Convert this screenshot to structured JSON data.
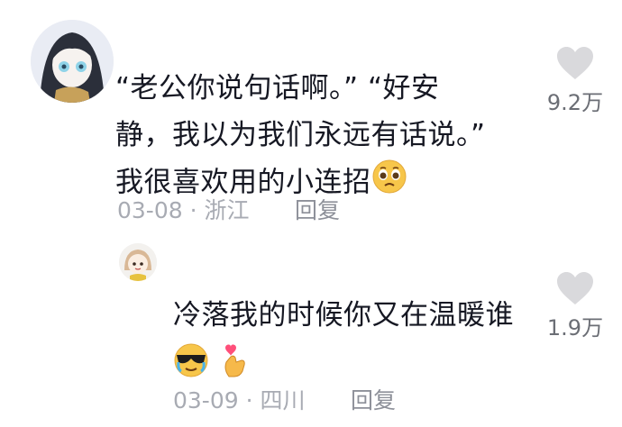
{
  "comments": [
    {
      "text_line1": "“老公你说句话啊。” “好安",
      "text_line2": "静，我以为我们永远有话说。”",
      "text_line3": "我很喜欢用的小连招",
      "date": "03-08",
      "separator": "·",
      "location": "浙江",
      "reply_label": "回复",
      "like_count": "9.2万",
      "emojis": [
        "pleading-face-icon"
      ]
    },
    {
      "text_line1": "冷落我的时候你又在温暖谁",
      "date": "03-09",
      "separator": "·",
      "location": "四川",
      "reply_label": "回复",
      "like_count": "1.9万",
      "emojis": [
        "cool-crying-face-icon",
        "heart-fingers-icon"
      ]
    }
  ],
  "colors": {
    "text": "#161823",
    "meta": "#a8abb3",
    "heart": "#d9d9dc"
  }
}
